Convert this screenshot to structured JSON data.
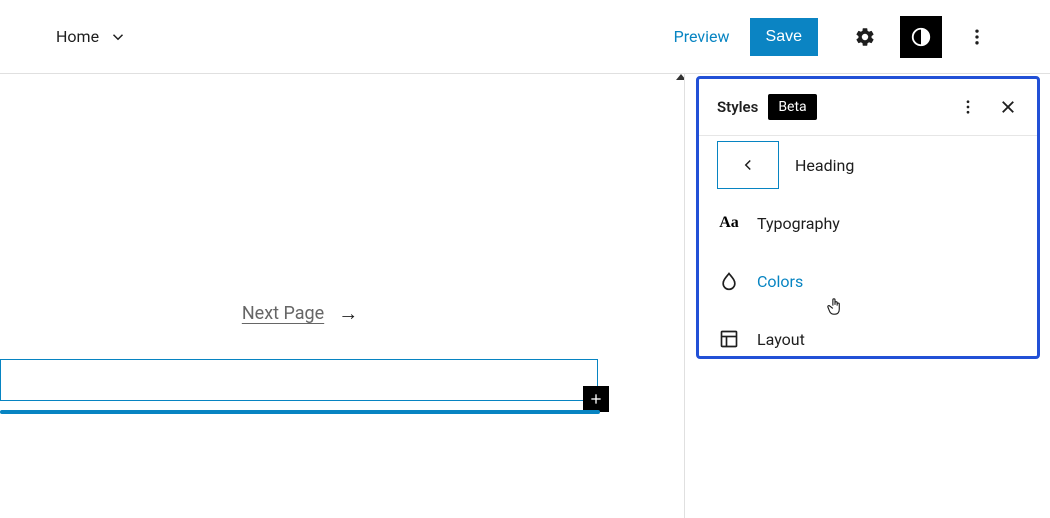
{
  "header": {
    "home_label": "Home",
    "preview_label": "Preview",
    "save_label": "Save"
  },
  "canvas": {
    "next_page_label": "Next Page"
  },
  "styles_panel": {
    "title": "Styles",
    "badge": "Beta",
    "back_section": "Heading",
    "items": [
      {
        "label": "Typography",
        "active": false
      },
      {
        "label": "Colors",
        "active": true
      },
      {
        "label": "Layout",
        "active": false
      }
    ]
  }
}
